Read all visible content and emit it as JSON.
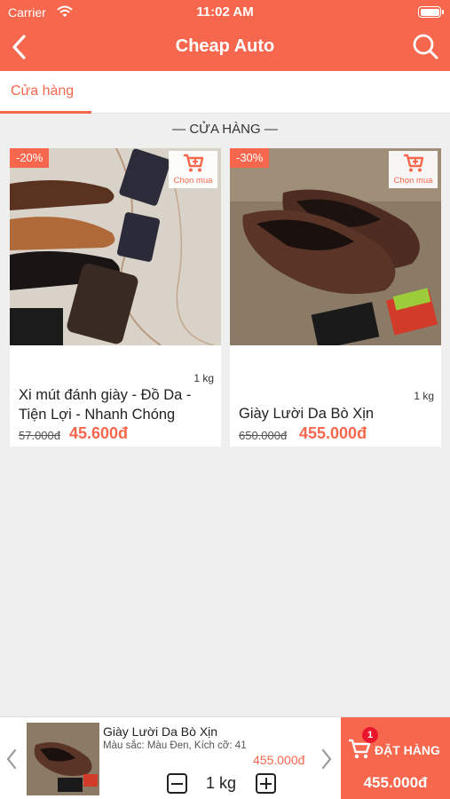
{
  "status_bar": {
    "carrier": "Carrier",
    "time": "11:02 AM"
  },
  "nav": {
    "title": "Cheap Auto",
    "back_icon": "chevron-left-icon",
    "search_icon": "search-icon"
  },
  "tabs": [
    {
      "label": "Cửa hàng",
      "active": true
    }
  ],
  "section_title": "— CỬA HÀNG —",
  "products": [
    {
      "discount": "-20%",
      "buy_label": "Chọn mua",
      "weight": "1 kg",
      "name": "Xi mút đánh giày - Đồ Da - Tiện Lợi - Nhanh Chóng",
      "old_price": "57.000đ",
      "new_price": "45.600đ"
    },
    {
      "discount": "-30%",
      "buy_label": "Chọn mua",
      "weight": "1 kg",
      "name": "Giày Lười Da Bò Xịn",
      "old_price": "650.000đ",
      "new_price": "455.000đ"
    }
  ],
  "cart_bar": {
    "name": "Giày Lười Da Bò Xịn",
    "variant": "Màu sắc: Màu Đen, Kích cỡ: 41",
    "price": "455.000đ",
    "quantity": "1 kg",
    "badge": "1",
    "order_label": "ĐẶT HÀNG",
    "total": "455.000đ"
  },
  "colors": {
    "accent": "#f7674d",
    "badge": "#e8162c",
    "background": "#efefef"
  }
}
